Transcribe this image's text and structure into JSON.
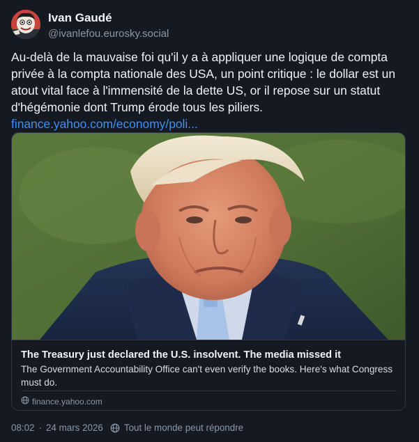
{
  "author": {
    "name": "Ivan Gaudé",
    "handle": "@ivanlefou.eurosky.social",
    "avatar_icon": "cartoon-face-avatar"
  },
  "post": {
    "text": "Au-delà de la mauvaise foi qu'il y a à appliquer une logique de compta privée à la compta nationale des USA, un point critique : le dollar est un atout vital face à l'immensité de la dette US, or il repose sur un statut d'hégémonie dont Trump érode tous les piliers.",
    "link_text": "finance.yahoo.com/economy/poli..."
  },
  "card": {
    "image_alt": "Photo of Donald Trump frowning, outdoors",
    "title": "The Treasury just declared the U.S. insolvent. The media missed it",
    "description": "The Government Accountability Office can't even verify the books. Here's what Congress must do.",
    "domain": "finance.yahoo.com",
    "domain_icon": "globe-icon"
  },
  "meta": {
    "time": "08:02",
    "separator": "·",
    "date": "24 mars 2026",
    "reply_setting": "Tout le monde peut répondre",
    "reply_icon": "globe-icon"
  },
  "colors": {
    "background": "#151a22",
    "link": "#3f8ff0",
    "muted": "#8a96a6",
    "border": "#2e3642"
  }
}
